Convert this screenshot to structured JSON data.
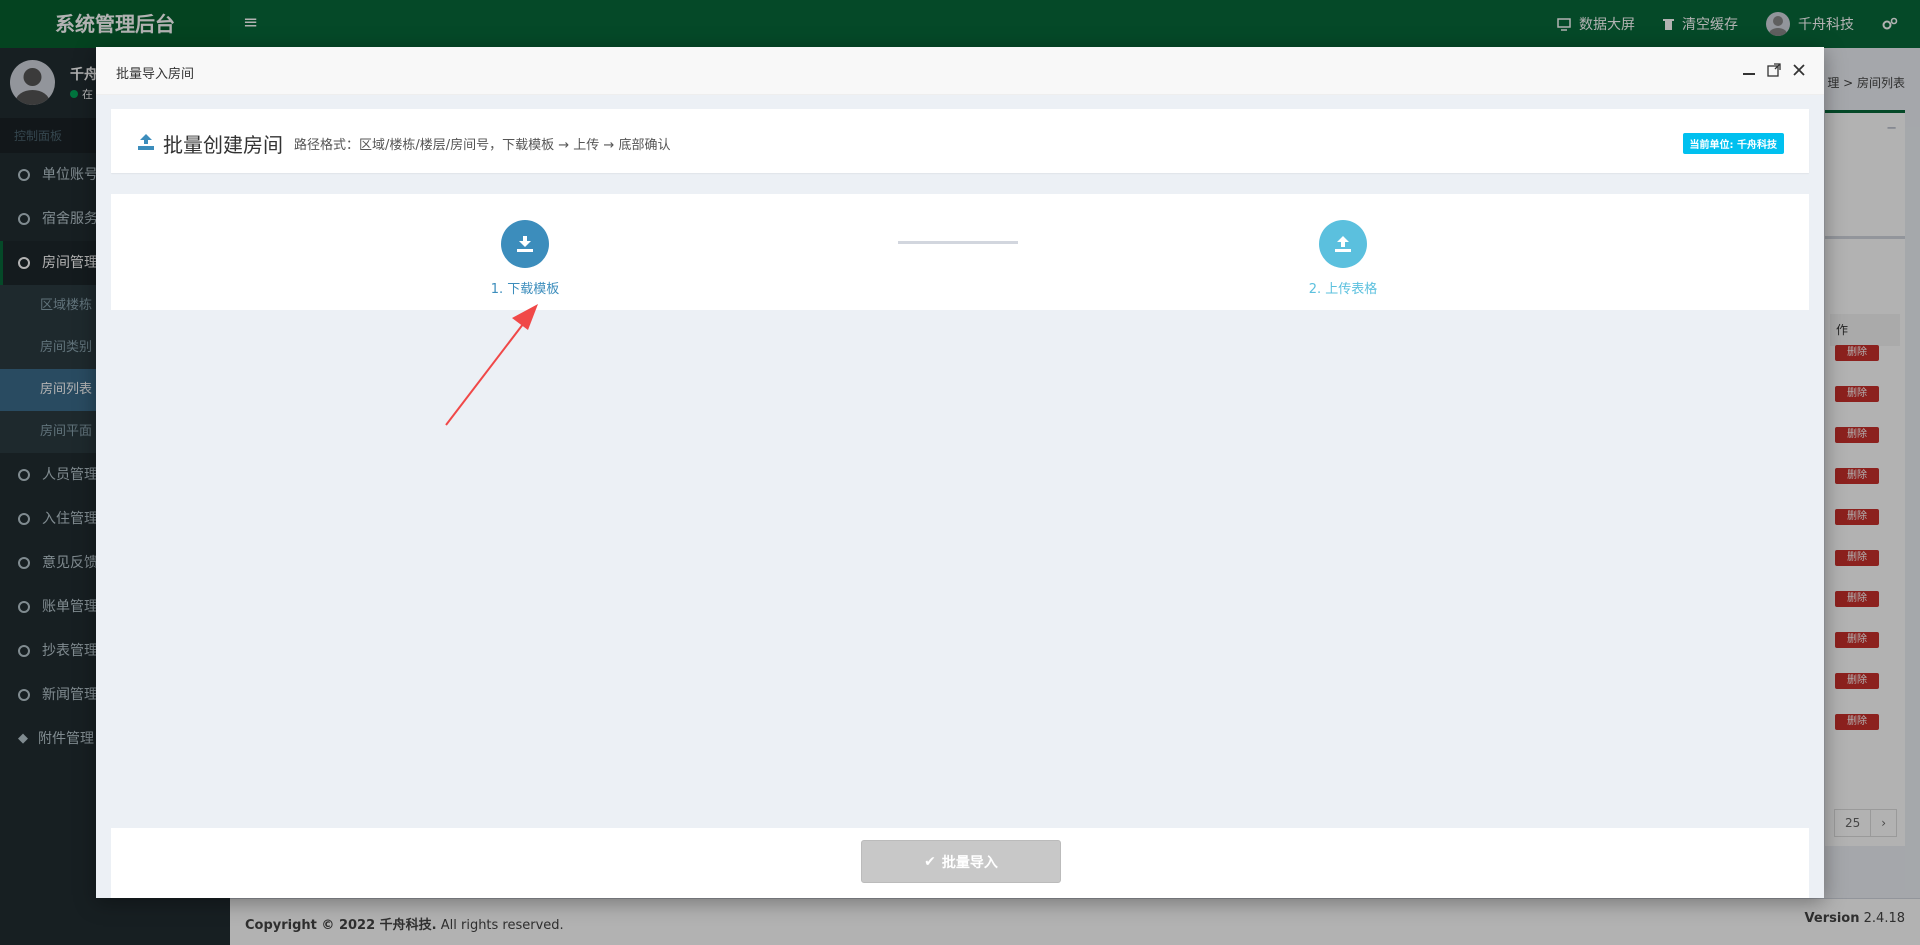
{
  "app": {
    "brand": "系统管理后台",
    "top_actions": [
      {
        "label": "数据大屏",
        "icon": "monitor-icon"
      },
      {
        "label": "清空缓存",
        "icon": "trash-icon"
      },
      {
        "label": "千舟科技",
        "icon": "user-avatar"
      }
    ]
  },
  "sidebar": {
    "user_name": "千舟",
    "user_status": "在",
    "header": "控制面板",
    "items": [
      {
        "label": "单位账号"
      },
      {
        "label": "宿舍服务"
      },
      {
        "label": "房间管理"
      },
      {
        "label": "人员管理"
      },
      {
        "label": "入住管理"
      },
      {
        "label": "意见反馈"
      },
      {
        "label": "账单管理"
      },
      {
        "label": "抄表管理"
      },
      {
        "label": "新闻管理"
      },
      {
        "label": "附件管理"
      }
    ],
    "sub_items": [
      {
        "label": "区域楼栋"
      },
      {
        "label": "房间类别"
      },
      {
        "label": "房间列表"
      },
      {
        "label": "房间平面"
      }
    ]
  },
  "background": {
    "breadcrumb": "理 > 房间列表",
    "col_header": "作",
    "delete_label": "删除",
    "pager_page": "25",
    "pager_next": "›"
  },
  "footer": {
    "copyright": "Copyright © 2022 千舟科技.",
    "rights": "All rights reserved.",
    "version_label": "Version",
    "version": "2.4.18"
  },
  "modal": {
    "title": "批量导入房间",
    "head_title": "批量创建房间",
    "path_hint": "路径格式：区域/楼栋/楼层/房间号，下载模板 → 上传 → 底部确认",
    "unit_badge": "当前单位: 千舟科技",
    "step1": "1. 下载模板",
    "step2": "2. 上传表格",
    "import_button": "批量导入",
    "colors": {
      "step1": "#3c8dbc",
      "step2": "#5bc0de",
      "brand": "#08693a"
    }
  }
}
